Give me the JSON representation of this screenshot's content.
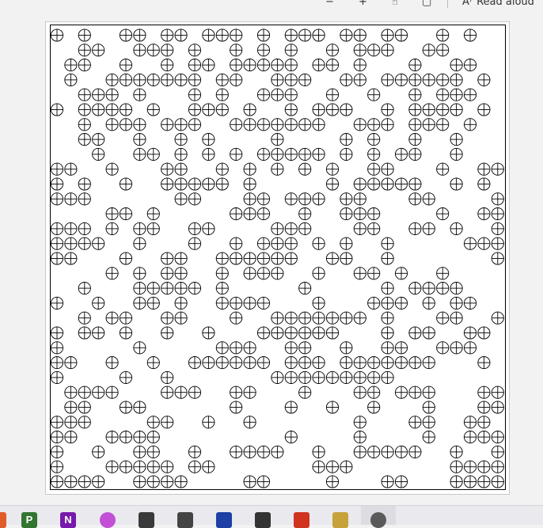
{
  "toolbar": {
    "read_aloud_label": "Read aloud",
    "read_aloud_glyph": "A⁾"
  },
  "icons": {
    "minus": "−",
    "plus": "+",
    "touch": "☝",
    "fit": "▢"
  },
  "symbol": "⊕",
  "grid_rows": [
    "X.X..XX.XX.XXX.X.XXX.XX.XX..X.X.",
    "..XX..XXX.X..X.X.X..X.XXX..XX...",
    ".XX..X..X.XX.XXXXX.XX.X...X..XX.",
    ".X..XXXXXXX.XX..XXX..XX.XXXXXX.X",
    "..XXX.X...X.X..XXX..X..X..X.XXX.",
    "X.XXXX.X..XXX.X..X.XXX..X.XXXX.X",
    "..X.XXX.XXX..XXXXXXX..XXX.XXX.X.",
    "..XX..X..X.X....X....X.X..X..X..",
    "...X..XX.X.X.X.XXXXX.X.X.XX..X..",
    "XX..X...XX..X.X.X.X.X..XX...X..XX",
    "X.X..X..XXXXX.X.....X.XXXXX..X.X.X",
    "XXX......XX...XX.XXX.XX...XX....XXX",
    "....XX.X.....XXX..X..XXX....X..XX...",
    "XXX.X.XX..XX....XXX...XX..XX.X..XXX",
    "XXXX..X...X..X.XXX.X.X..X.....XXXX.",
    "XX...X..XX..XXXXXX..XX..X.......XX.",
    "....X.X.XX..X.XXX..X..XX.X..X.....",
    "..X...XXXXX.X.....X.....X.XXXX...X.",
    "X..X..XX.X..XXXX...X...XXX.X.XX..X.X",
    "..X.XX..XX...X..XXXXXXX.X...XX..XX...",
    "X.XX.X..X..X...XXXXXX...X.XX..XX..XX.",
    "X.....X.....XXX..XX..X..XX..XXX...X.X",
    "XX..X..X..XXXXXX.XXX.XXXXXXX...X..X.X",
    "X....X..X.......XXXXXXXXX.........X.X",
    ".XXXX...XXX..XX...X...XX.XXX...XXXX.",
    ".XX..XX......X...X..X..X...X...XX.XX",
    "XXX....XX..X..X.......X...XX..XX..XXX",
    "XX..XXXX.........X....X....X..XXX..XX",
    "X..X..XX..X..XXXX..X..XXXXX..X..XX..X",
    "X...XXXXX.XX.......XXX.......XXXXX..X",
    "XXXX..XXXX....XX....X...XX...XXXX.XXXX"
  ]
}
